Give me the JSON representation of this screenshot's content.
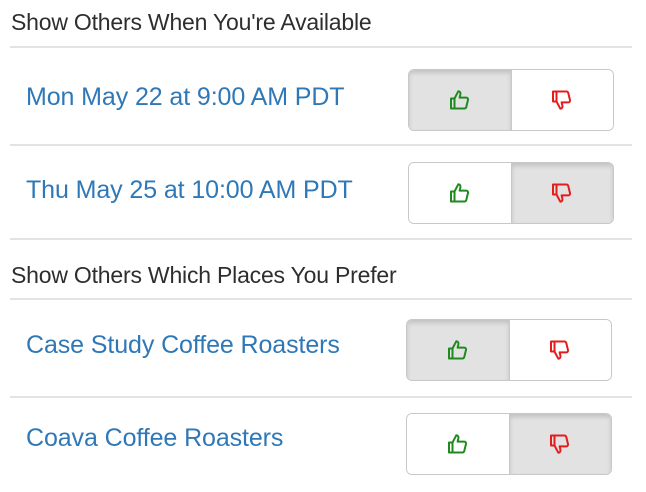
{
  "availability": {
    "heading": "Show Others When You're Available",
    "items": [
      {
        "label": "Mon May 22 at 9:00 AM PDT",
        "vote": "up"
      },
      {
        "label": "Thu May 25 at 10:00 AM PDT",
        "vote": "down"
      }
    ]
  },
  "places": {
    "heading": "Show Others Which Places You Prefer",
    "items": [
      {
        "label": "Case Study Coffee Roasters",
        "vote": "up"
      },
      {
        "label": "Coava Coffee Roasters",
        "vote": "down"
      }
    ]
  },
  "icons": {
    "up": "thumbs-up-icon",
    "down": "thumbs-down-icon"
  },
  "colors": {
    "link": "#2f78b7",
    "thumb_up": "#1f8a1f",
    "thumb_down": "#e51c1c",
    "active_bg": "#e2e2e2"
  }
}
